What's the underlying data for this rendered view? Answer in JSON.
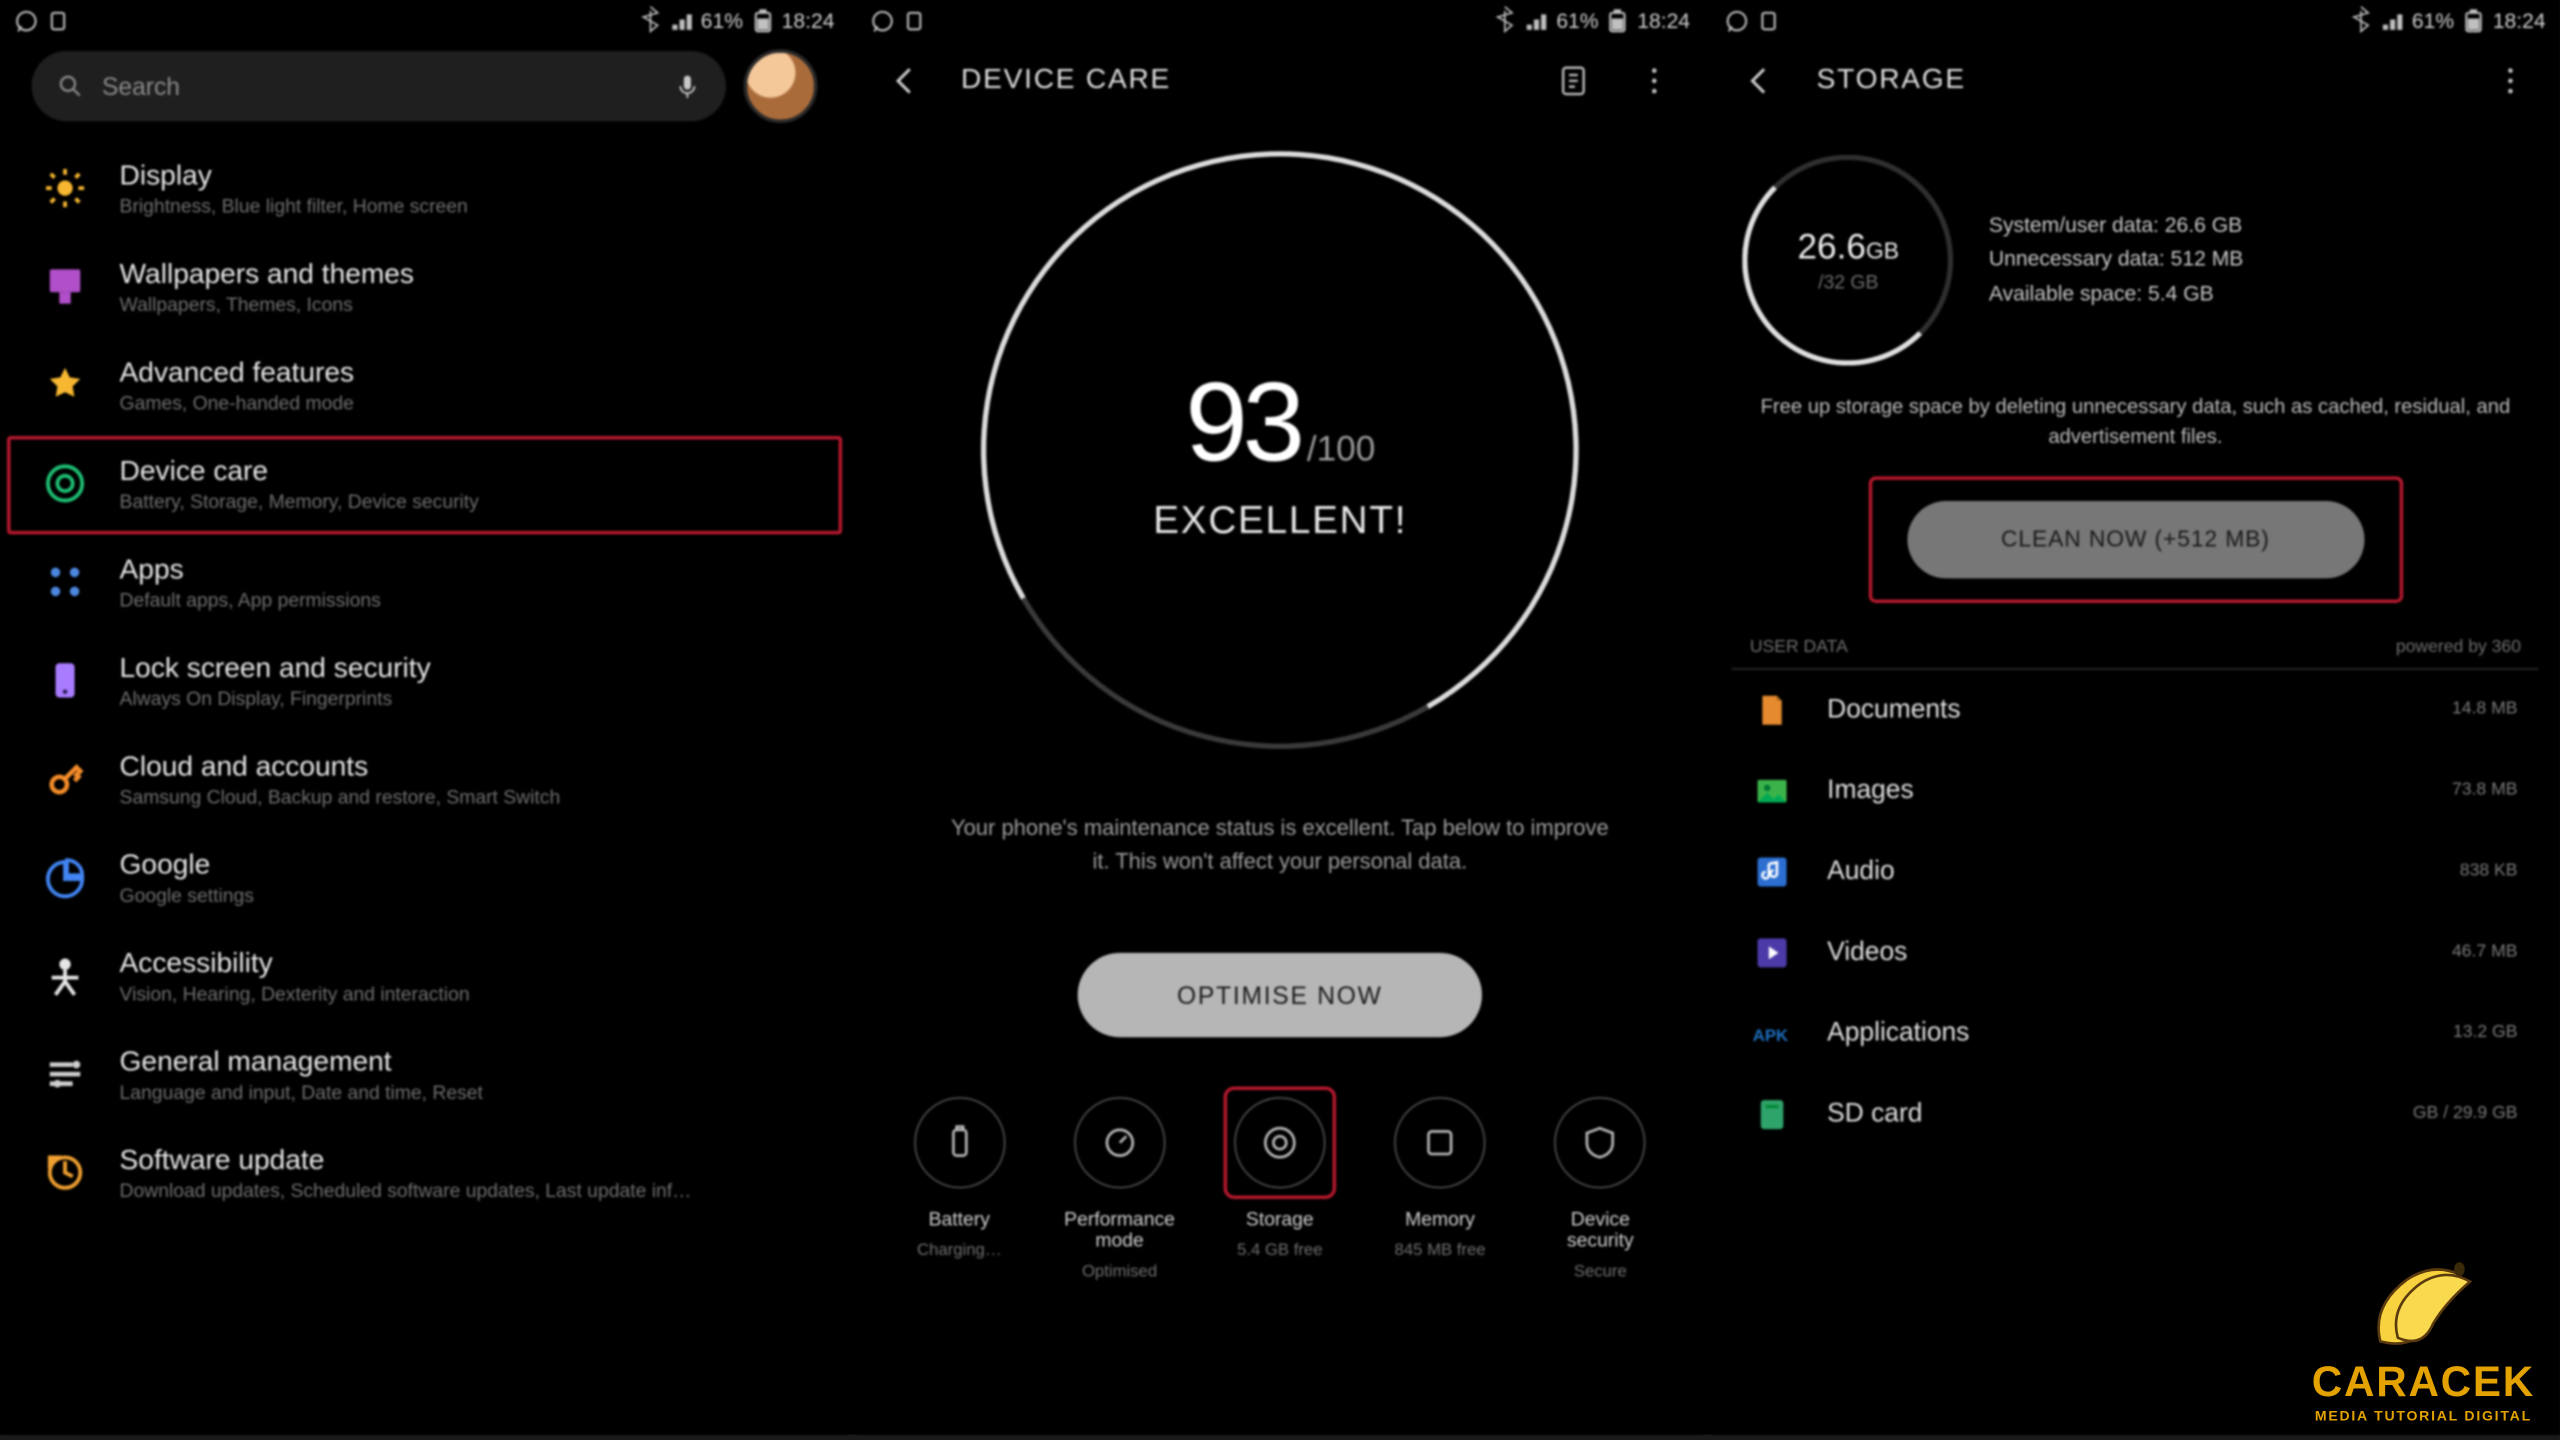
{
  "status": {
    "battery": "61%",
    "time": "18:24"
  },
  "s1": {
    "search_ph": "Search",
    "items": [
      {
        "title": "Display",
        "sub": "Brightness, Blue light filter, Home screen"
      },
      {
        "title": "Wallpapers and themes",
        "sub": "Wallpapers, Themes, Icons"
      },
      {
        "title": "Advanced features",
        "sub": "Games, One-handed mode"
      },
      {
        "title": "Device care",
        "sub": "Battery, Storage, Memory, Device security"
      },
      {
        "title": "Apps",
        "sub": "Default apps, App permissions"
      },
      {
        "title": "Lock screen and security",
        "sub": "Always On Display, Fingerprints"
      },
      {
        "title": "Cloud and accounts",
        "sub": "Samsung Cloud, Backup and restore, Smart Switch"
      },
      {
        "title": "Google",
        "sub": "Google settings"
      },
      {
        "title": "Accessibility",
        "sub": "Vision, Hearing, Dexterity and interaction"
      },
      {
        "title": "General management",
        "sub": "Language and input, Date and time, Reset"
      },
      {
        "title": "Software update",
        "sub": "Download updates, Scheduled software updates, Last update inf…"
      }
    ]
  },
  "s2": {
    "hdr": "DEVICE CARE",
    "score": "93",
    "max": "/100",
    "label": "EXCELLENT!",
    "msg": "Your phone's maintenance status is excellent. Tap below to improve it. This won't affect your personal data.",
    "btn": "OPTIMISE NOW",
    "tabs": [
      {
        "lbl": "Battery",
        "sub": "Charging…"
      },
      {
        "lbl": "Performance mode",
        "sub": "Optimised"
      },
      {
        "lbl": "Storage",
        "sub": "5.4 GB free"
      },
      {
        "lbl": "Memory",
        "sub": "845 MB free"
      },
      {
        "lbl": "Device security",
        "sub": "Secure"
      }
    ]
  },
  "s3": {
    "hdr": "STORAGE",
    "used": "26.6",
    "unit": "GB",
    "total": "/32 GB",
    "info": {
      "a": "System/user data: 26.6 GB",
      "b": "Unnecessary data: 512 MB",
      "c": "Available space: 5.4 GB"
    },
    "desc": "Free up storage space by deleting unnecessary data, such as cached, residual, and advertisement files.",
    "clean": "CLEAN NOW (+512 MB)",
    "user_data": "USER DATA",
    "powered": "powered by  360",
    "cats": [
      {
        "l": "Documents",
        "s": "14.8 MB",
        "c": "#e58a2e"
      },
      {
        "l": "Images",
        "s": "73.8 MB",
        "c": "#3cb34a"
      },
      {
        "l": "Audio",
        "s": "838 KB",
        "c": "#2c6fd1"
      },
      {
        "l": "Videos",
        "s": "46.7 MB",
        "c": "#4b3aa8"
      },
      {
        "l": "Applications",
        "s": "13.2 GB",
        "c": "#1e6fc0"
      },
      {
        "l": "SD card",
        "s": "GB / 29.9 GB",
        "c": "#2ea36a"
      }
    ]
  },
  "wm": {
    "t1": "CARACEK",
    "t2": "MEDIA TUTORIAL DIGITAL"
  }
}
